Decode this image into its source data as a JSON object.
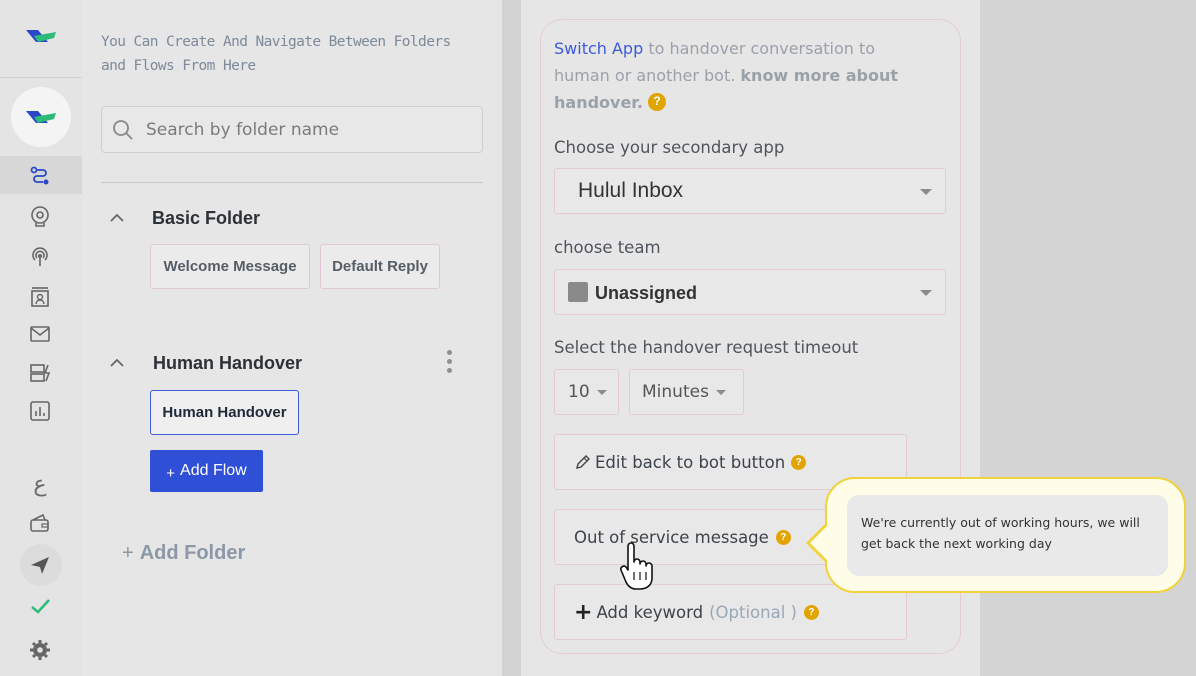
{
  "sidebar": {
    "icons": [
      "logo-icon",
      "bot-avatar-icon",
      "flows-icon",
      "ai-brain-icon",
      "broadcast-icon",
      "contacts-icon",
      "inbox-icon",
      "integrations-icon",
      "analytics-icon",
      "language-icon",
      "wallet-icon",
      "send-icon",
      "check-icon",
      "settings-icon"
    ],
    "language_glyph": "ع",
    "brand_colors": {
      "green": "#2dbb7a",
      "blue": "#2a47c8",
      "active_icon": "#2a47c8"
    }
  },
  "folders_panel": {
    "intro": "You Can Create And Navigate Between Folders and Flows From Here",
    "search_placeholder": "Search by folder name",
    "folders": [
      {
        "title": "Basic Folder",
        "flows": [
          "Welcome Message",
          "Default Reply"
        ]
      },
      {
        "title": "Human Handover",
        "flows": [
          "Human Handover"
        ]
      }
    ],
    "add_flow_label": "Add Flow",
    "add_flow_plus": "+",
    "add_folder_label": "Add Folder",
    "add_folder_plus": "+"
  },
  "handover": {
    "desc_link": "Switch App",
    "desc_text": " to handover conversation to human or another bot. ",
    "desc_bold": "know more about handover.",
    "help_glyph": "?",
    "secondary_app_label": "Choose your secondary app",
    "secondary_app_value": "Hulul Inbox",
    "team_label": "choose team",
    "team_value": "Unassigned",
    "timeout_label": "Select the handover request timeout",
    "timeout_value": "10",
    "timeout_unit": "Minutes",
    "edit_back_label": "Edit back to bot button",
    "out_of_service_label": "Out of service message",
    "add_keyword_label": "Add keyword",
    "add_keyword_optional": "(Optional )",
    "add_keyword_plus": "+"
  },
  "tooltip": {
    "text": "We're currently out of working hours, we will get back the next working day"
  }
}
